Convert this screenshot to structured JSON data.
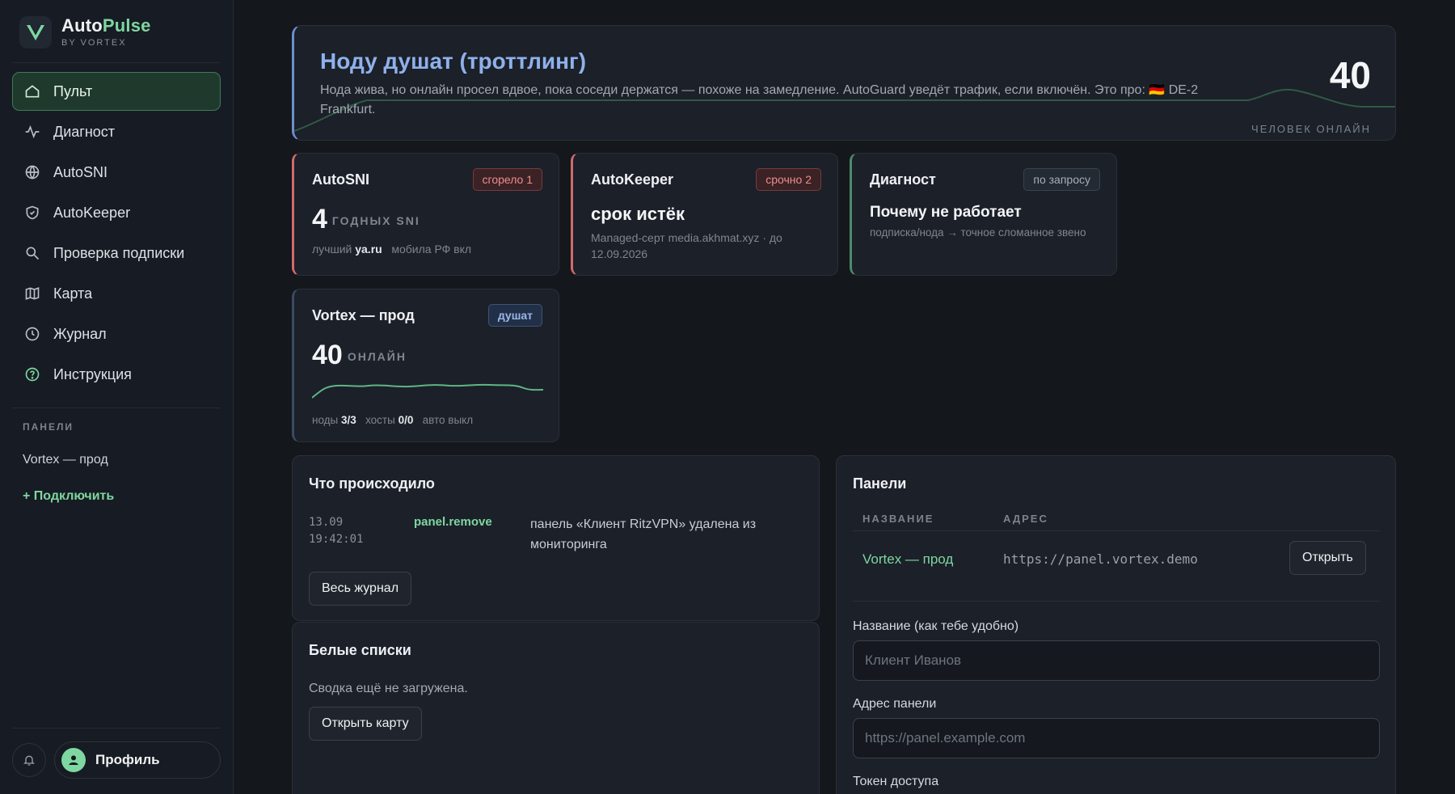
{
  "brand": {
    "name_part1": "Auto",
    "name_part2": "Pulse",
    "subtitle": "BY VORTEX"
  },
  "nav": [
    {
      "label": "Пульт",
      "icon": "home-icon",
      "active": true
    },
    {
      "label": "Диагност",
      "icon": "activity-icon"
    },
    {
      "label": "AutoSNI",
      "icon": "globe-icon"
    },
    {
      "label": "AutoKeeper",
      "icon": "shield-icon"
    },
    {
      "label": "Проверка подписки",
      "icon": "search-icon"
    },
    {
      "label": "Карта",
      "icon": "map-icon"
    },
    {
      "label": "Журнал",
      "icon": "clock-icon"
    },
    {
      "label": "Инструкция",
      "icon": "help-circle-icon"
    }
  ],
  "sidebar": {
    "section_label": "ПАНЕЛИ",
    "panel_link": "Vortex — прод",
    "connect_label": "+ Подключить",
    "profile_label": "Профиль"
  },
  "banner": {
    "title": "Ноду душат (троттлинг)",
    "description": "Нода жива, но онлайн просел вдвое, пока соседи держатся — похоже на замедление. AutoGuard уведёт трафик, если включён. Это про: 🇩🇪 DE-2 Frankfurt.",
    "count": "40",
    "count_label": "ЧЕЛОВЕК ОНЛАЙН"
  },
  "cards": {
    "autosni": {
      "title": "AutoSNI",
      "badge": "сгорело 1",
      "value": "4",
      "value_label": "ГОДНЫХ SNI",
      "sub_prefix": "лучший",
      "sub_best": "ya.ru",
      "sub_suffix": "мобила РФ вкл"
    },
    "autokeeper": {
      "title": "AutoKeeper",
      "badge": "срочно 2",
      "headline": "срок истёк",
      "sub": "Managed-серт media.akhmat.xyz · до 12.09.2026"
    },
    "diag": {
      "title": "Диагност",
      "badge": "по запросу",
      "headline": "Почему не работает",
      "sub": "подписка/нода → точное сломанное звено"
    },
    "vortex": {
      "title": "Vortex — прод",
      "badge": "душат",
      "value": "40",
      "value_label": "ОНЛАЙН",
      "nodes_label": "ноды",
      "nodes_value": "3/3",
      "hosts_label": "хосты",
      "hosts_value": "0/0",
      "auto_label": "авто выкл"
    }
  },
  "events": {
    "title": "Что происходило",
    "items": [
      {
        "time_date": "13.09",
        "time_clock": "19:42:01",
        "event": "panel.remove",
        "text": "панель «Клиент RitzVPN» удалена из мониторинга"
      }
    ],
    "button": "Весь журнал"
  },
  "whitelists": {
    "title": "Белые списки",
    "text": "Сводка ещё не загружена.",
    "button": "Открыть карту"
  },
  "panels": {
    "title": "Панели",
    "col_name": "НАЗВАНИЕ",
    "col_addr": "АДРЕС",
    "rows": [
      {
        "name": "Vortex — прод",
        "addr": "https://panel.vortex.demo",
        "action": "Открыть"
      }
    ],
    "form": {
      "name_label": "Название (как тебе удобно)",
      "name_placeholder": "Клиент Иванов",
      "addr_label": "Адрес панели",
      "addr_placeholder": "https://panel.example.com",
      "token_label": "Токен доступа"
    }
  },
  "colors": {
    "accent": "#7ed6a0",
    "danger": "#d46a6a",
    "info": "#8fb0ea",
    "background": "#14171c"
  }
}
